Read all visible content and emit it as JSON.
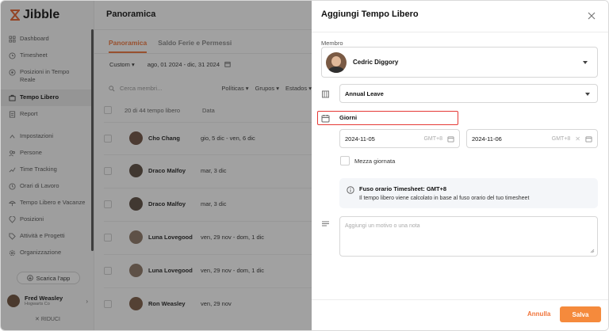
{
  "app": {
    "name": "Jibble",
    "brand_color": "#e8612c"
  },
  "sidebar": {
    "items": [
      {
        "label": "Dashboard",
        "icon": "dashboard-icon"
      },
      {
        "label": "Timesheet",
        "icon": "clock-icon"
      },
      {
        "label": "Posizioni in Tempo Reale",
        "icon": "location-icon"
      },
      {
        "label": "Tempo Libero",
        "icon": "suitcase-icon",
        "active": true
      },
      {
        "label": "Report",
        "icon": "report-icon"
      },
      {
        "label": "Impostazioni",
        "icon": "chevron-up-icon"
      },
      {
        "label": "Persone",
        "icon": "people-icon"
      },
      {
        "label": "Time Tracking",
        "icon": "tracking-icon"
      },
      {
        "label": "Orari di Lavoro",
        "icon": "schedule-icon"
      },
      {
        "label": "Tempo Libero e Vacanze",
        "icon": "vacation-icon"
      },
      {
        "label": "Posizioni",
        "icon": "pin-icon"
      },
      {
        "label": "Attività e Progetti",
        "icon": "tag-icon"
      },
      {
        "label": "Organizzazione",
        "icon": "gear-icon"
      }
    ],
    "download_label": "Scarica l'app",
    "user": {
      "name": "Fred Weasley",
      "company": "Hogwarts Co"
    },
    "collapse_label": "RIDUCI"
  },
  "main": {
    "title": "Panoramica",
    "tabs": [
      {
        "label": "Panoramica",
        "active": true
      },
      {
        "label": "Saldo Ferie e Permessi",
        "active": false
      }
    ],
    "range_select": "Custom",
    "date_range": "ago, 01 2024 - dic, 31 2024",
    "search_placeholder": "Cerca membri...",
    "filters": [
      "Políticas",
      "Grupos",
      "Estados"
    ],
    "count_label": "20 di 44 tempo libero",
    "date_column": "Data",
    "rows": [
      {
        "name": "Cho Chang",
        "date": "gio, 5 dic - ven, 6 dic"
      },
      {
        "name": "Draco Malfoy",
        "date": "mar, 3 dic"
      },
      {
        "name": "Draco Malfoy",
        "date": "mar, 3 dic"
      },
      {
        "name": "Luna Lovegood",
        "date": "ven, 29 nov - dom, 1 dic"
      },
      {
        "name": "Luna Lovegood",
        "date": "ven, 29 nov - dom, 1 dic"
      },
      {
        "name": "Ron Weasley",
        "date": "ven, 29 nov"
      }
    ]
  },
  "panel": {
    "title": "Aggiungi Tempo Libero",
    "member_label": "Membro",
    "member_name": "Cedric Diggory",
    "leave_type": "Annual Leave",
    "days_label": "Giorni",
    "start_date": "2024-11-05",
    "end_date": "2024-11-06",
    "timezone": "GMT+8",
    "half_day_label": "Mezza giornata",
    "info_title": "Fuso orario Timesheet: GMT+8",
    "info_text": "Il tempo libero viene calcolato in base al fuso orario del tuo timesheet",
    "note_placeholder": "Aggiungi un motivo o una nota",
    "cancel_label": "Annulla",
    "save_label": "Salva",
    "accent_color": "#f58a3c",
    "highlight_color": "#e53935"
  }
}
